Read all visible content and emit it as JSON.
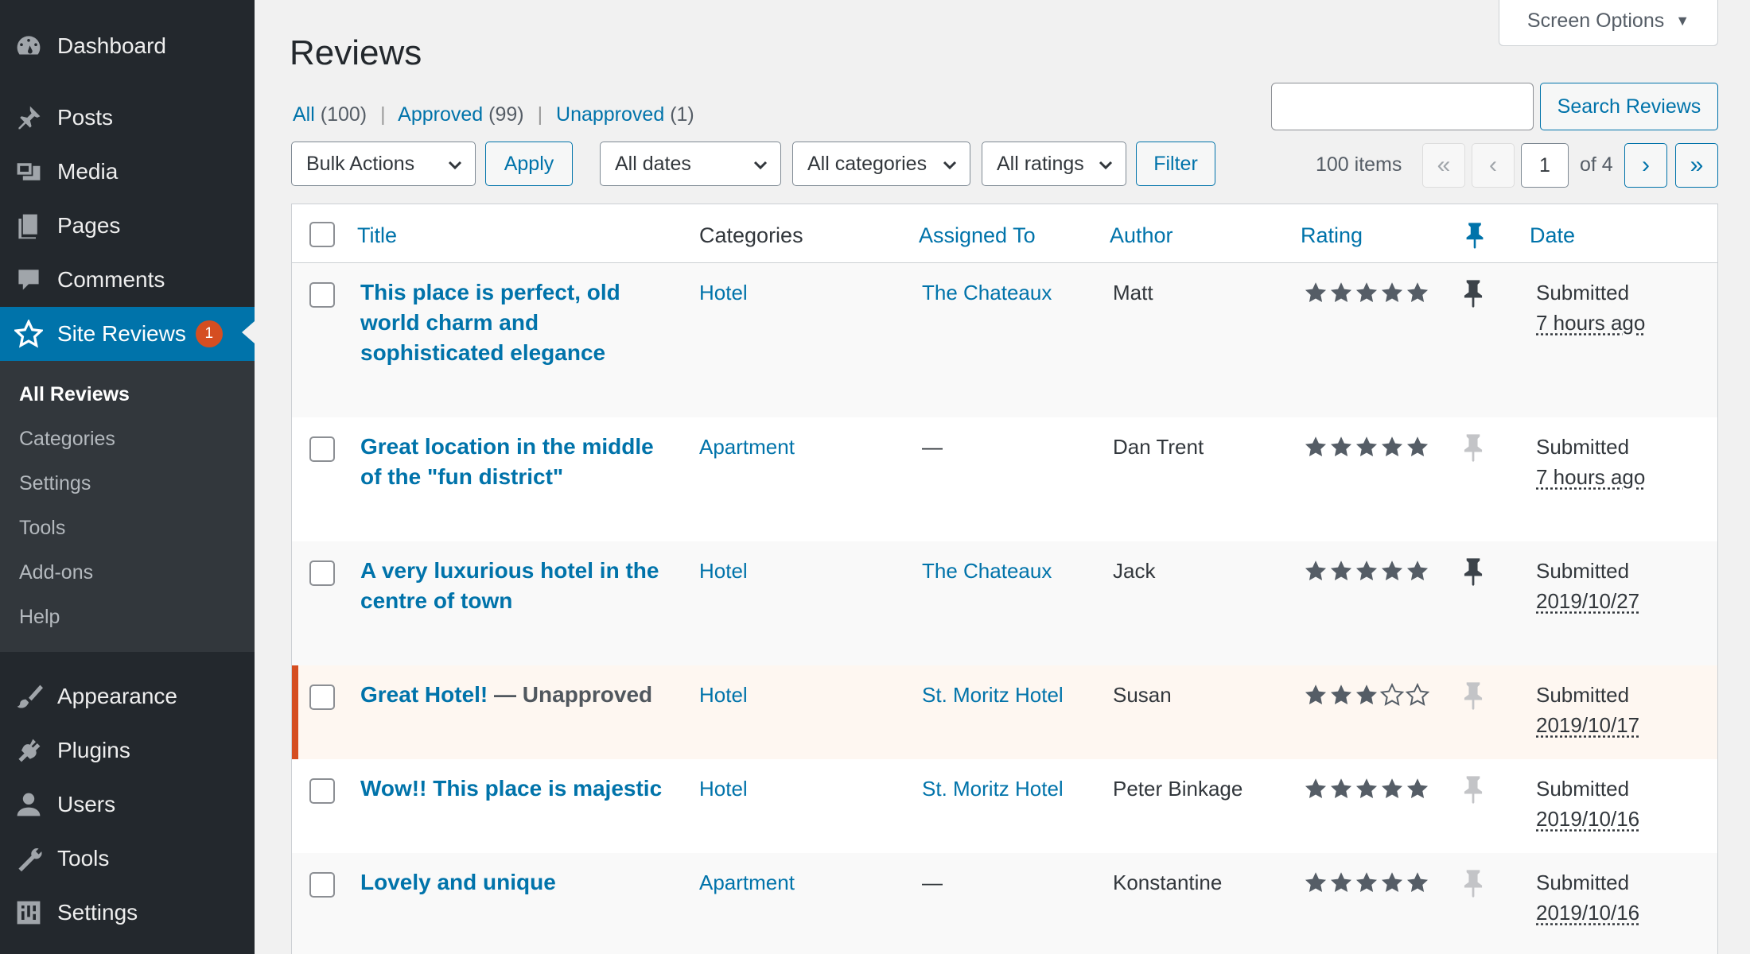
{
  "sidebar": {
    "menu": [
      {
        "label": "Dashboard",
        "icon": "dashboard-icon"
      },
      {
        "label": "Posts",
        "icon": "pushpin-icon"
      },
      {
        "label": "Media",
        "icon": "media-icon"
      },
      {
        "label": "Pages",
        "icon": "pages-icon"
      },
      {
        "label": "Comments",
        "icon": "comment-icon"
      },
      {
        "label": "Site Reviews",
        "icon": "star-icon",
        "badge": "1"
      },
      {
        "label": "Appearance",
        "icon": "brush-icon"
      },
      {
        "label": "Plugins",
        "icon": "plugin-icon"
      },
      {
        "label": "Users",
        "icon": "user-icon"
      },
      {
        "label": "Tools",
        "icon": "wrench-icon"
      },
      {
        "label": "Settings",
        "icon": "settings-icon"
      }
    ],
    "submenu": [
      "All Reviews",
      "Categories",
      "Settings",
      "Tools",
      "Add-ons",
      "Help"
    ]
  },
  "screen_options": "Screen Options",
  "page_title": "Reviews",
  "filters_status": {
    "all": "All",
    "all_count": "(100)",
    "approved": "Approved",
    "approved_count": "(99)",
    "unapproved": "Unapproved",
    "unapproved_count": "(1)",
    "sep": "|"
  },
  "search": {
    "value": "",
    "button": "Search Reviews"
  },
  "toolbar": {
    "bulk_actions": "Bulk Actions",
    "apply": "Apply",
    "dates": "All dates",
    "categories": "All categories",
    "ratings": "All ratings",
    "filter": "Filter"
  },
  "pagination": {
    "items": "100 items",
    "first": "«",
    "prev": "‹",
    "next": "›",
    "last": "»",
    "current": "1",
    "of": "of 4"
  },
  "table": {
    "columns": {
      "title": "Title",
      "categories": "Categories",
      "assigned": "Assigned To",
      "author": "Author",
      "rating": "Rating",
      "date": "Date"
    },
    "rows": [
      {
        "title": "This place is perfect, old world charm and sophisticated elegance",
        "state": "",
        "category": "Hotel",
        "assigned": "The Chateaux",
        "author": "Matt",
        "rating": 5,
        "pinned": true,
        "submitted": "Submitted",
        "when": "7 hours ago"
      },
      {
        "title": "Great location in the middle of the \"fun district\"",
        "state": "",
        "category": "Apartment",
        "assigned": "—",
        "author": "Dan Trent",
        "rating": 5,
        "pinned": false,
        "submitted": "Submitted",
        "when": "7 hours ago"
      },
      {
        "title": "A very luxurious hotel in the centre of town",
        "state": "",
        "category": "Hotel",
        "assigned": "The Chateaux",
        "author": "Jack",
        "rating": 5,
        "pinned": true,
        "submitted": "Submitted",
        "when": "2019/10/27"
      },
      {
        "title": "Great Hotel!",
        "state": " — Unapproved",
        "category": "Hotel",
        "assigned": "St. Moritz Hotel",
        "author": "Susan",
        "rating": 3,
        "pinned": false,
        "submitted": "Submitted",
        "when": "2019/10/17"
      },
      {
        "title": "Wow!! This place is majestic",
        "state": "",
        "category": "Hotel",
        "assigned": "St. Moritz Hotel",
        "author": "Peter Binkage",
        "rating": 5,
        "pinned": false,
        "submitted": "Submitted",
        "when": "2019/10/16"
      },
      {
        "title": "Lovely and unique",
        "state": "",
        "category": "Apartment",
        "assigned": "—",
        "author": "Konstantine",
        "rating": 5,
        "pinned": false,
        "submitted": "Submitted",
        "when": "2019/10/16"
      }
    ]
  },
  "colors": {
    "accent": "#0073aa",
    "sidebar": "#23282d",
    "submenu": "#32373c",
    "badge": "#d54e21",
    "unapproved_bg": "#fef7f1",
    "star": "#555d66",
    "pin_off": "#c3c4c7"
  }
}
